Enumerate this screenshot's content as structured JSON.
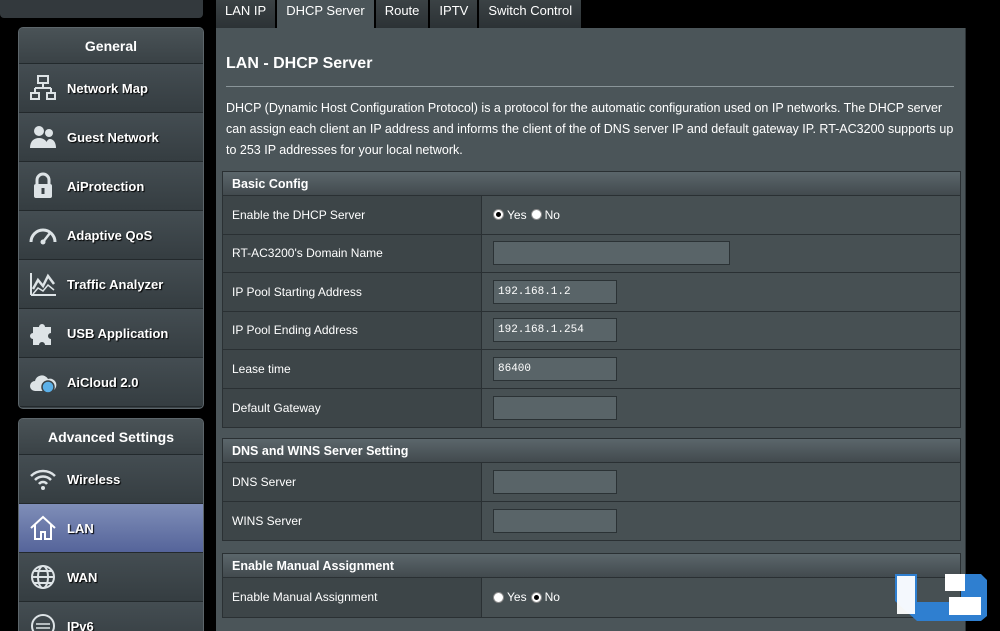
{
  "sidebar": {
    "general_header": "General",
    "general_items": [
      {
        "label": "Network Map",
        "icon": "network-map-icon"
      },
      {
        "label": "Guest Network",
        "icon": "guest-network-icon"
      },
      {
        "label": "AiProtection",
        "icon": "lock-icon"
      },
      {
        "label": "Adaptive QoS",
        "icon": "speedometer-icon"
      },
      {
        "label": "Traffic Analyzer",
        "icon": "chart-icon"
      },
      {
        "label": "USB Application",
        "icon": "puzzle-icon"
      },
      {
        "label": "AiCloud 2.0",
        "icon": "cloud-icon"
      }
    ],
    "advanced_header": "Advanced Settings",
    "advanced_items": [
      {
        "label": "Wireless",
        "icon": "wifi-icon"
      },
      {
        "label": "LAN",
        "icon": "home-icon",
        "active": true
      },
      {
        "label": "WAN",
        "icon": "globe-icon"
      },
      {
        "label": "IPv6",
        "icon": "ipv6-icon"
      }
    ]
  },
  "tabs": [
    {
      "label": "LAN IP"
    },
    {
      "label": "DHCP Server",
      "active": true
    },
    {
      "label": "Route"
    },
    {
      "label": "IPTV"
    },
    {
      "label": "Switch Control"
    }
  ],
  "page": {
    "title": "LAN - DHCP Server",
    "description": "DHCP (Dynamic Host Configuration Protocol) is a protocol for the automatic configuration used on IP networks. The DHCP server can assign each client an IP address and informs the client of the of DNS server IP and default gateway IP. RT-AC3200 supports up to 253 IP addresses for your local network."
  },
  "basic_config": {
    "header": "Basic Config",
    "enable_dhcp_label": "Enable the DHCP Server",
    "yes": "Yes",
    "no": "No",
    "enable_dhcp_value": "Yes",
    "domain_name_label": "RT-AC3200's Domain Name",
    "domain_name_value": "",
    "pool_start_label": "IP Pool Starting Address",
    "pool_start_value": "192.168.1.2",
    "pool_end_label": "IP Pool Ending Address",
    "pool_end_value": "192.168.1.254",
    "lease_label": "Lease time",
    "lease_value": "86400",
    "gateway_label": "Default Gateway",
    "gateway_value": ""
  },
  "dns_wins": {
    "header": "DNS and WINS Server Setting",
    "dns_label": "DNS Server",
    "dns_value": "",
    "wins_label": "WINS Server",
    "wins_value": ""
  },
  "manual_assignment": {
    "header": "Enable Manual Assignment",
    "label": "Enable Manual Assignment",
    "yes": "Yes",
    "no": "No",
    "value": "No"
  },
  "colors": {
    "active_nav": "#6f7fb0",
    "panel_bg": "#4b5559",
    "logo_blue": "#2f7fd0"
  }
}
